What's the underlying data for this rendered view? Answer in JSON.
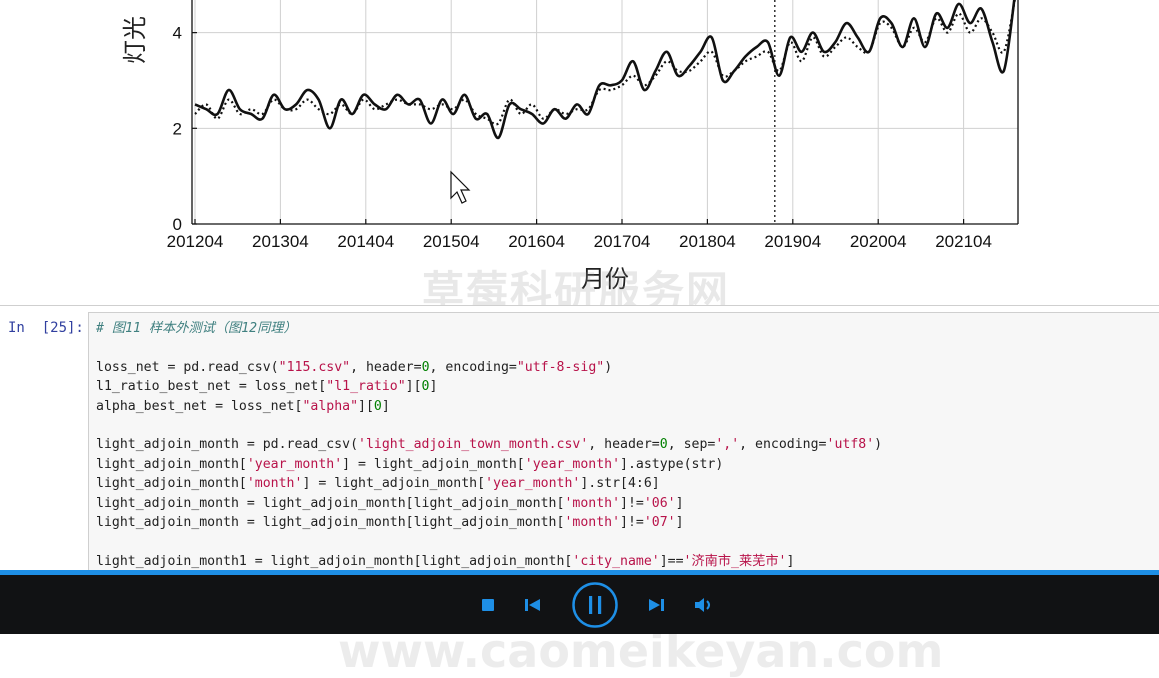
{
  "chart_data": {
    "type": "line",
    "ylabel": "灯光",
    "xlabel": "月份",
    "x_ticks": [
      "201204",
      "201304",
      "201404",
      "201504",
      "201604",
      "201704",
      "201804",
      "201904",
      "202004",
      "202104"
    ],
    "y_ticks": [
      "0",
      "2",
      "4"
    ],
    "ylim": [
      0,
      5.1
    ],
    "grid": true,
    "vline_at": "201810",
    "series": [
      {
        "style": "solid",
        "values": [
          2.5,
          2.4,
          2.3,
          2.8,
          2.4,
          2.3,
          2.2,
          2.7,
          2.4,
          2.5,
          2.8,
          2.6,
          2.0,
          2.6,
          2.3,
          2.7,
          2.5,
          2.4,
          2.7,
          2.5,
          2.6,
          2.1,
          2.6,
          2.3,
          2.7,
          2.2,
          2.3,
          1.8,
          2.5,
          2.4,
          2.3,
          2.1,
          2.4,
          2.2,
          2.5,
          2.3,
          2.9,
          2.9,
          3.0,
          3.4,
          2.8,
          3.2,
          3.6,
          3.1,
          3.3,
          3.6,
          3.9,
          3.0,
          3.2,
          3.5,
          3.7,
          3.8,
          3.1,
          3.9,
          3.6,
          4.0,
          3.6,
          3.8,
          4.2,
          3.9,
          3.6,
          4.3,
          4.2,
          3.7,
          4.3,
          3.7,
          4.4,
          4.1,
          4.6,
          4.2,
          4.5,
          3.8,
          3.2,
          4.8
        ]
      },
      {
        "style": "dotted",
        "values": [
          2.3,
          2.5,
          2.2,
          2.6,
          2.3,
          2.4,
          2.3,
          2.6,
          2.4,
          2.4,
          2.6,
          2.4,
          2.3,
          2.5,
          2.3,
          2.6,
          2.4,
          2.5,
          2.6,
          2.5,
          2.5,
          2.4,
          2.5,
          2.4,
          2.6,
          2.3,
          2.2,
          2.1,
          2.6,
          2.3,
          2.5,
          2.2,
          2.4,
          2.3,
          2.4,
          2.4,
          2.8,
          2.8,
          2.9,
          3.1,
          2.9,
          3.1,
          3.4,
          3.2,
          3.2,
          3.4,
          3.6,
          3.1,
          3.2,
          3.4,
          3.5,
          3.6,
          3.2,
          3.8,
          3.4,
          3.9,
          3.5,
          3.7,
          3.9,
          3.7,
          3.6,
          4.2,
          4.1,
          3.7,
          4.1,
          3.8,
          4.3,
          4.0,
          4.4,
          4.0,
          4.3,
          4.0,
          3.6,
          4.7
        ]
      }
    ]
  },
  "watermark": {
    "line1": "草莓科研服务网",
    "line2": "www.caomeikeyan.com"
  },
  "cell": {
    "prompt": "In  [25]:",
    "comment": "# 图11 样本外测试（图12同理）",
    "lines": [
      {
        "pre": "loss_net = pd.read_csv(",
        "str1": "\"115.csv\"",
        "mid": ", header=",
        "num": "0",
        "mid2": ", encoding=",
        "str2": "\"utf-8-sig\"",
        "post": ")"
      },
      {
        "pre": "l1_ratio_best_net = loss_net[",
        "str1": "\"l1_ratio\"",
        "mid": "][",
        "num": "0",
        "post": "]"
      },
      {
        "pre": "alpha_best_net = loss_net[",
        "str1": "\"alpha\"",
        "mid": "][",
        "num": "0",
        "post": "]"
      },
      {
        "pre": "light_adjoin_month = pd.read_csv(",
        "str1": "'light_adjoin_town_month.csv'",
        "mid": ", header=",
        "num": "0",
        "mid2": ", sep=",
        "str2": "','",
        "mid3": ", encoding=",
        "str3": "'utf8'",
        "post": ")"
      },
      {
        "pre": "light_adjoin_month[",
        "str1": "'year_month'",
        "mid": "] = light_adjoin_month[",
        "str2": "'year_month'",
        "post": "].astype(str)"
      },
      {
        "pre": "light_adjoin_month[",
        "str1": "'month'",
        "mid": "] = light_adjoin_month[",
        "str2": "'year_month'",
        "post": "].str[4:6]"
      },
      {
        "pre": "light_adjoin_month = light_adjoin_month[light_adjoin_month[",
        "str1": "'month'",
        "mid": "]!=",
        "str2": "'06'",
        "post": "]"
      },
      {
        "pre": "light_adjoin_month = light_adjoin_month[light_adjoin_month[",
        "str1": "'month'",
        "mid": "]!=",
        "str2": "'07'",
        "post": "]"
      },
      {
        "pre": "light_adjoin_month1 = light_adjoin_month[light_adjoin_month[",
        "str1": "'city_name'",
        "mid": "]==",
        "str2": "'济南市_莱芜市'",
        "post": "]"
      }
    ]
  },
  "player": {
    "progress": 1.0,
    "icons": [
      "stop-icon",
      "previous-icon",
      "pause-icon",
      "next-icon",
      "volume-icon"
    ],
    "accent": "#1e8fe6"
  }
}
